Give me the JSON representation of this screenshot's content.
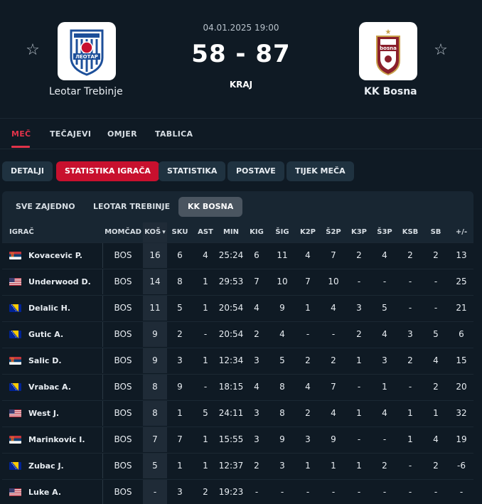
{
  "match": {
    "datetime": "04.01.2025 19:00",
    "score": "58 - 87",
    "status": "KRAJ",
    "home_team": "Leotar Trebinje",
    "away_team": "KK Bosna",
    "favorite_icon": "star-outline-icon",
    "home_logo_text": "ЛЕОТАР",
    "away_logo_text": "bosna"
  },
  "main_tabs": [
    {
      "label": "MEČ"
    },
    {
      "label": "TEČAJEVI"
    },
    {
      "label": "OMJER"
    },
    {
      "label": "TABLICA"
    }
  ],
  "sub_tabs": [
    {
      "label": "DETALJI"
    },
    {
      "label": "STATISTIKA IGRAČA"
    },
    {
      "label": "STATISTIKA"
    },
    {
      "label": "POSTAVE"
    },
    {
      "label": "TIJEK MEČA"
    }
  ],
  "team_filters": [
    {
      "label": "SVE ZAJEDNO"
    },
    {
      "label": "LEOTAR TREBINJE"
    },
    {
      "label": "KK BOSNA"
    }
  ],
  "columns": [
    "IGRAČ",
    "MOMČAD",
    "KOŠ",
    "SKU",
    "AST",
    "MIN",
    "KIG",
    "ŠIG",
    "K2P",
    "Š2P",
    "K3P",
    "Š3P",
    "KSB",
    "SB",
    "+/-"
  ],
  "sort_indicator": "▾",
  "colors": {
    "accent": "#e0334a",
    "active_pill": "#c8102e",
    "background": "#0f1a24"
  },
  "players": [
    {
      "flag": "srb",
      "name": "Kovacevic P.",
      "team": "BOS",
      "kos": "16",
      "sku": "6",
      "ast": "4",
      "min": "25:24",
      "kig": "6",
      "sig": "11",
      "k2p": "4",
      "s2p": "7",
      "k3p": "2",
      "s3p": "4",
      "ksb": "2",
      "sb": "2",
      "pm": "13"
    },
    {
      "flag": "usa",
      "name": "Underwood D.",
      "team": "BOS",
      "kos": "14",
      "sku": "8",
      "ast": "1",
      "min": "29:53",
      "kig": "7",
      "sig": "10",
      "k2p": "7",
      "s2p": "10",
      "k3p": "-",
      "s3p": "-",
      "ksb": "-",
      "sb": "-",
      "pm": "25"
    },
    {
      "flag": "bih",
      "name": "Delalic H.",
      "team": "BOS",
      "kos": "11",
      "sku": "5",
      "ast": "1",
      "min": "20:54",
      "kig": "4",
      "sig": "9",
      "k2p": "1",
      "s2p": "4",
      "k3p": "3",
      "s3p": "5",
      "ksb": "-",
      "sb": "-",
      "pm": "21"
    },
    {
      "flag": "bih",
      "name": "Gutic A.",
      "team": "BOS",
      "kos": "9",
      "sku": "2",
      "ast": "-",
      "min": "20:54",
      "kig": "2",
      "sig": "4",
      "k2p": "-",
      "s2p": "-",
      "k3p": "2",
      "s3p": "4",
      "ksb": "3",
      "sb": "5",
      "pm": "6"
    },
    {
      "flag": "srb",
      "name": "Salic D.",
      "team": "BOS",
      "kos": "9",
      "sku": "3",
      "ast": "1",
      "min": "12:34",
      "kig": "3",
      "sig": "5",
      "k2p": "2",
      "s2p": "2",
      "k3p": "1",
      "s3p": "3",
      "ksb": "2",
      "sb": "4",
      "pm": "15"
    },
    {
      "flag": "bih",
      "name": "Vrabac A.",
      "team": "BOS",
      "kos": "8",
      "sku": "9",
      "ast": "-",
      "min": "18:15",
      "kig": "4",
      "sig": "8",
      "k2p": "4",
      "s2p": "7",
      "k3p": "-",
      "s3p": "1",
      "ksb": "-",
      "sb": "2",
      "pm": "20"
    },
    {
      "flag": "usa",
      "name": "West J.",
      "team": "BOS",
      "kos": "8",
      "sku": "1",
      "ast": "5",
      "min": "24:11",
      "kig": "3",
      "sig": "8",
      "k2p": "2",
      "s2p": "4",
      "k3p": "1",
      "s3p": "4",
      "ksb": "1",
      "sb": "1",
      "pm": "32"
    },
    {
      "flag": "srb",
      "name": "Marinkovic I.",
      "team": "BOS",
      "kos": "7",
      "sku": "7",
      "ast": "1",
      "min": "15:55",
      "kig": "3",
      "sig": "9",
      "k2p": "3",
      "s2p": "9",
      "k3p": "-",
      "s3p": "-",
      "ksb": "1",
      "sb": "4",
      "pm": "19"
    },
    {
      "flag": "bih",
      "name": "Zubac J.",
      "team": "BOS",
      "kos": "5",
      "sku": "1",
      "ast": "1",
      "min": "12:37",
      "kig": "2",
      "sig": "3",
      "k2p": "1",
      "s2p": "1",
      "k3p": "1",
      "s3p": "2",
      "ksb": "-",
      "sb": "2",
      "pm": "-6"
    },
    {
      "flag": "usa",
      "name": "Luke A.",
      "team": "BOS",
      "kos": "-",
      "sku": "3",
      "ast": "2",
      "min": "19:23",
      "kig": "-",
      "sig": "-",
      "k2p": "-",
      "s2p": "-",
      "k3p": "-",
      "s3p": "-",
      "ksb": "-",
      "sb": "-",
      "pm": "-"
    }
  ]
}
